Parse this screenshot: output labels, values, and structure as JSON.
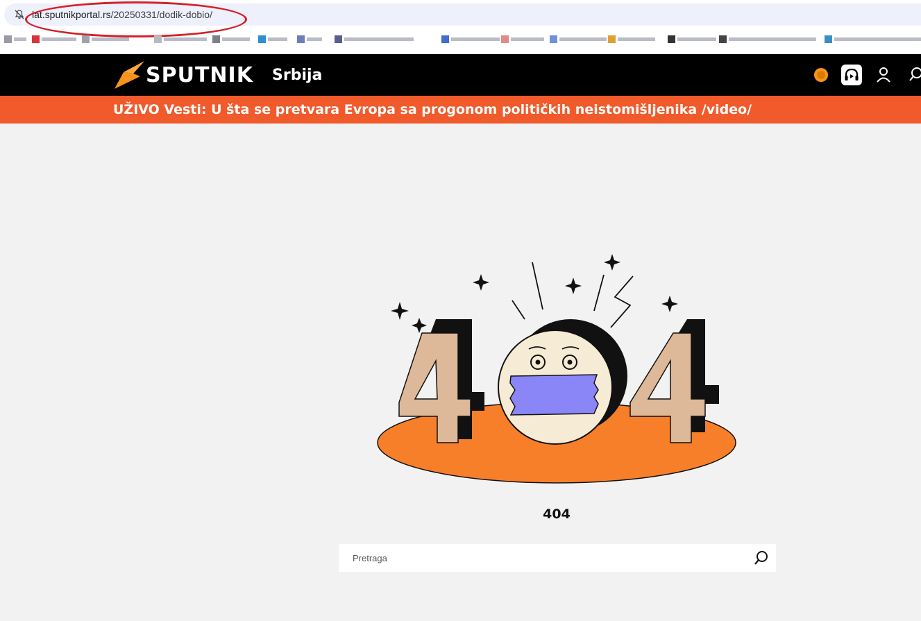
{
  "browser": {
    "url_host": "lat.sputnikportal.rs",
    "url_path": "/20250331/dodik-dobio/"
  },
  "header": {
    "brand": "SPUTNIK",
    "region": "Srbija",
    "brand_color": "#f15a2b"
  },
  "breaking": {
    "text": "UŽIVO Vesti: U šta se pretvara Evropa sa progonom političkih neistomišljenika /video/"
  },
  "error": {
    "illustration_text": "404",
    "code": "404"
  },
  "search": {
    "placeholder": "Pretraga"
  },
  "icons": {
    "notifications": "notifications-off-icon",
    "live": "live-dot-icon",
    "radio": "headphones-icon",
    "user": "user-icon",
    "search": "search-icon"
  }
}
